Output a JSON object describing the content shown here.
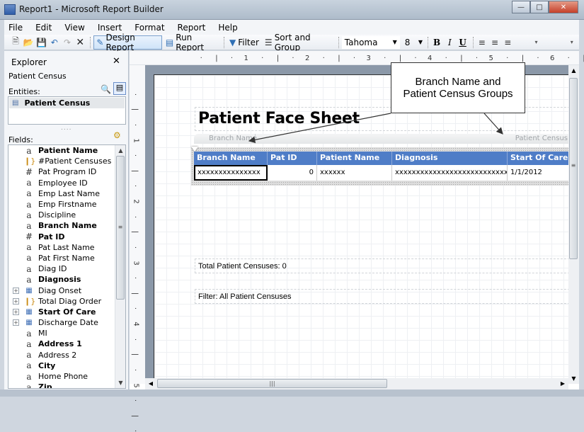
{
  "window": {
    "title": "Report1 - Microsoft Report Builder",
    "controls": [
      "minimize",
      "maximize",
      "close"
    ]
  },
  "menu": [
    "File",
    "Edit",
    "View",
    "Insert",
    "Format",
    "Report",
    "Help"
  ],
  "toolbar": {
    "design_report": "Design Report",
    "run_report": "Run Report",
    "filter": "Filter",
    "sort_group": "Sort and Group",
    "font_name": "Tahoma",
    "font_size": "8",
    "bold": "B",
    "italic": "I",
    "underline": "U"
  },
  "explorer": {
    "title": "Explorer",
    "data_source": "Patient Census",
    "entities_label": "Entities:",
    "entity": "Patient Census",
    "fields_label": "Fields:",
    "fields": [
      {
        "label": "Patient Name",
        "icon": "text",
        "bold": true
      },
      {
        "label": "#Patient Censuses",
        "icon": "calc",
        "bold": false
      },
      {
        "label": "Pat Program ID",
        "icon": "number",
        "bold": false
      },
      {
        "label": "Employee ID",
        "icon": "text",
        "bold": false
      },
      {
        "label": "Emp Last Name",
        "icon": "text",
        "bold": false
      },
      {
        "label": "Emp Firstname",
        "icon": "text",
        "bold": false
      },
      {
        "label": "Discipline",
        "icon": "text",
        "bold": false
      },
      {
        "label": "Branch Name",
        "icon": "text",
        "bold": true
      },
      {
        "label": "Pat ID",
        "icon": "number",
        "bold": true
      },
      {
        "label": "Pat Last Name",
        "icon": "text",
        "bold": false
      },
      {
        "label": "Pat First Name",
        "icon": "text",
        "bold": false
      },
      {
        "label": "Diag ID",
        "icon": "text",
        "bold": false
      },
      {
        "label": "Diagnosis",
        "icon": "text",
        "bold": true
      },
      {
        "label": "Diag Onset",
        "icon": "date",
        "bold": false,
        "expandable": true
      },
      {
        "label": "Total Diag Order",
        "icon": "calc",
        "bold": false,
        "expandable": true
      },
      {
        "label": "Start Of Care",
        "icon": "date",
        "bold": true,
        "expandable": true
      },
      {
        "label": "Discharge Date",
        "icon": "date",
        "bold": false,
        "expandable": true
      },
      {
        "label": "MI",
        "icon": "text",
        "bold": false
      },
      {
        "label": "Address 1",
        "icon": "text",
        "bold": true
      },
      {
        "label": "Address 2",
        "icon": "text",
        "bold": false
      },
      {
        "label": "City",
        "icon": "text",
        "bold": true
      },
      {
        "label": "Home Phone",
        "icon": "text",
        "bold": false
      },
      {
        "label": "Zip",
        "icon": "text",
        "bold": true
      }
    ]
  },
  "ruler": {
    "horizontal": [
      "1",
      "2",
      "3",
      "4",
      "5",
      "6"
    ],
    "vertical": [
      "1",
      "2",
      "3",
      "4",
      "5"
    ]
  },
  "report": {
    "title": "Patient Face Sheet",
    "group_row": "Branch Name",
    "group_detail": "Patient Census",
    "columns": [
      "Branch Name",
      "Pat ID",
      "Patient Name",
      "Diagnosis",
      "Start Of Care"
    ],
    "row": [
      "xxxxxxxxxxxxxxx",
      "0",
      "xxxxxx",
      "xxxxxxxxxxxxxxxxxxxxxxxxxxxxxx",
      "1/1/2012"
    ],
    "total": "Total Patient Censuses: 0",
    "filter": "Filter: All Patient Censuses",
    "header_color": "#4f7dc7"
  },
  "callout": {
    "line1": "Branch Name and",
    "line2": "Patient Census Groups"
  }
}
